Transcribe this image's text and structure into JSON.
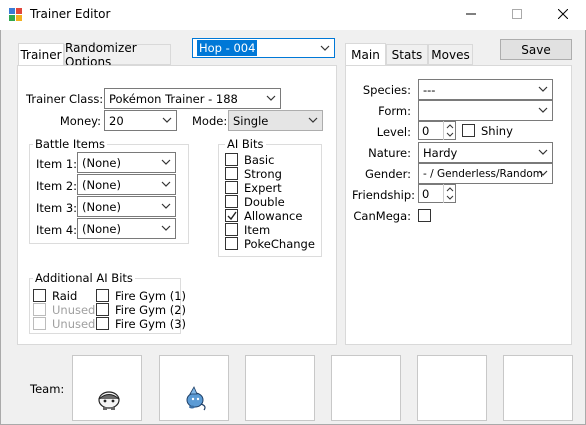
{
  "window": {
    "title": "Trainer Editor"
  },
  "trainer_select": {
    "value": "Hop - 004"
  },
  "left_tabs": [
    {
      "label": "Trainer"
    },
    {
      "label": "Randomizer Options"
    }
  ],
  "trainer": {
    "class_label": "Trainer Class:",
    "class_value": "Pokémon Trainer - 188",
    "money_label": "Money:",
    "money_value": "20",
    "mode_label": "Mode:",
    "mode_value": "Single",
    "battle_items": {
      "title": "Battle Items",
      "items": [
        {
          "label": "Item 1:",
          "value": "(None)"
        },
        {
          "label": "Item 2:",
          "value": "(None)"
        },
        {
          "label": "Item 3:",
          "value": "(None)"
        },
        {
          "label": "Item 4:",
          "value": "(None)"
        }
      ]
    },
    "ai_bits": {
      "title": "AI Bits",
      "items": [
        {
          "label": "Basic",
          "checked": false
        },
        {
          "label": "Strong",
          "checked": false
        },
        {
          "label": "Expert",
          "checked": false
        },
        {
          "label": "Double",
          "checked": false
        },
        {
          "label": "Allowance",
          "checked": true
        },
        {
          "label": "Item",
          "checked": false
        },
        {
          "label": "PokeChange",
          "checked": false
        }
      ]
    },
    "additional_ai_bits": {
      "title": "Additional AI Bits",
      "col1": [
        {
          "label": "Raid",
          "enabled": true
        },
        {
          "label": "Unused",
          "enabled": false
        },
        {
          "label": "Unused",
          "enabled": false
        }
      ],
      "col2": [
        {
          "label": "Fire Gym (1)",
          "enabled": true
        },
        {
          "label": "Fire Gym (2)",
          "enabled": true
        },
        {
          "label": "Fire Gym (3)",
          "enabled": true
        }
      ]
    }
  },
  "right_tabs": [
    {
      "label": "Main"
    },
    {
      "label": "Stats"
    },
    {
      "label": "Moves"
    }
  ],
  "save_button": {
    "label": "Save"
  },
  "main": {
    "species_label": "Species:",
    "species_value": "---",
    "form_label": "Form:",
    "form_value": "",
    "level_label": "Level:",
    "level_value": "0",
    "shiny_label": "Shiny",
    "nature_label": "Nature:",
    "nature_value": "Hardy",
    "gender_label": "Gender:",
    "gender_value": "- / Genderless/Random",
    "friendship_label": "Friendship:",
    "friendship_value": "0",
    "canmega_label": "CanMega:"
  },
  "team": {
    "label": "Team:",
    "slot_count": 6,
    "filled_slots": [
      0,
      1
    ]
  }
}
